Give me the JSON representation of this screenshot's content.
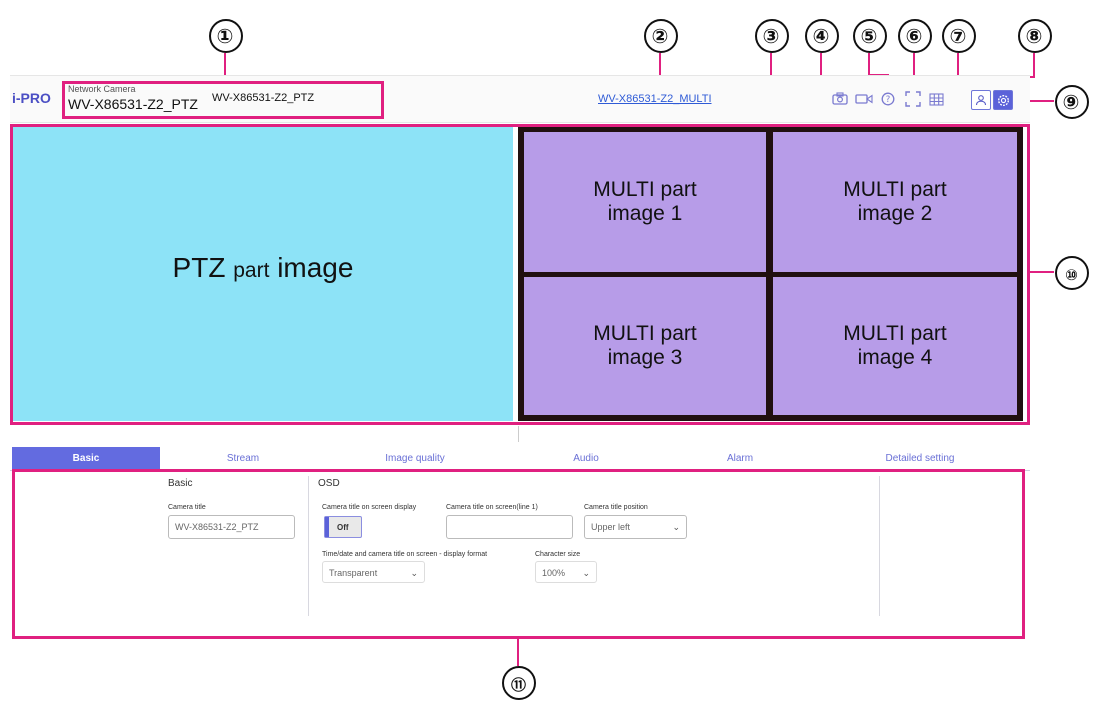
{
  "callouts": [
    "①",
    "②",
    "③",
    "④",
    "⑤",
    "⑥",
    "⑦",
    "⑧",
    "⑨",
    "⑩",
    "⑪"
  ],
  "header": {
    "logo": "i-PRO",
    "camera_label": "Network Camera",
    "camera_name": "WV-X86531-Z2_PTZ",
    "camera_title": "WV-X86531-Z2_PTZ",
    "multi_link": "WV-X86531-Z2_MULTI",
    "icons": [
      "snapshot-icon",
      "record-icon",
      "help-icon",
      "fullscreen-icon",
      "multiscreen-icon",
      "user-icon",
      "settings-icon"
    ]
  },
  "video": {
    "ptz_main": "PTZ",
    "ptz_small": "part",
    "ptz_end": "image",
    "multi": [
      {
        "line1": "MULTI part",
        "line2": "image 1"
      },
      {
        "line1": "MULTI part",
        "line2": "image 2"
      },
      {
        "line1": "MULTI part",
        "line2": "image 3"
      },
      {
        "line1": "MULTI part",
        "line2": "image 4"
      }
    ]
  },
  "tabs": [
    "Basic",
    "Stream",
    "Image quality",
    "Audio",
    "Alarm",
    "Detailed setting"
  ],
  "active_tab": "Basic",
  "basic": {
    "heading": "Basic",
    "camera_title_label": "Camera title",
    "camera_title_value": "WV-X86531-Z2_PTZ"
  },
  "osd": {
    "heading": "OSD",
    "display_label": "Camera title on screen display",
    "display_value": "Off",
    "line1_label": "Camera title on screen(line 1)",
    "line1_value": "",
    "position_label": "Camera title position",
    "position_value": "Upper left",
    "format_label": "Time/date and camera title on screen - display format",
    "format_value": "Transparent",
    "charsize_label": "Character size",
    "charsize_value": "100%"
  },
  "colors": {
    "accent": "#5b62d9",
    "callout_box": "#e02080",
    "ptz_bg": "#8de3f7",
    "multi_bg": "#b79ce8"
  }
}
